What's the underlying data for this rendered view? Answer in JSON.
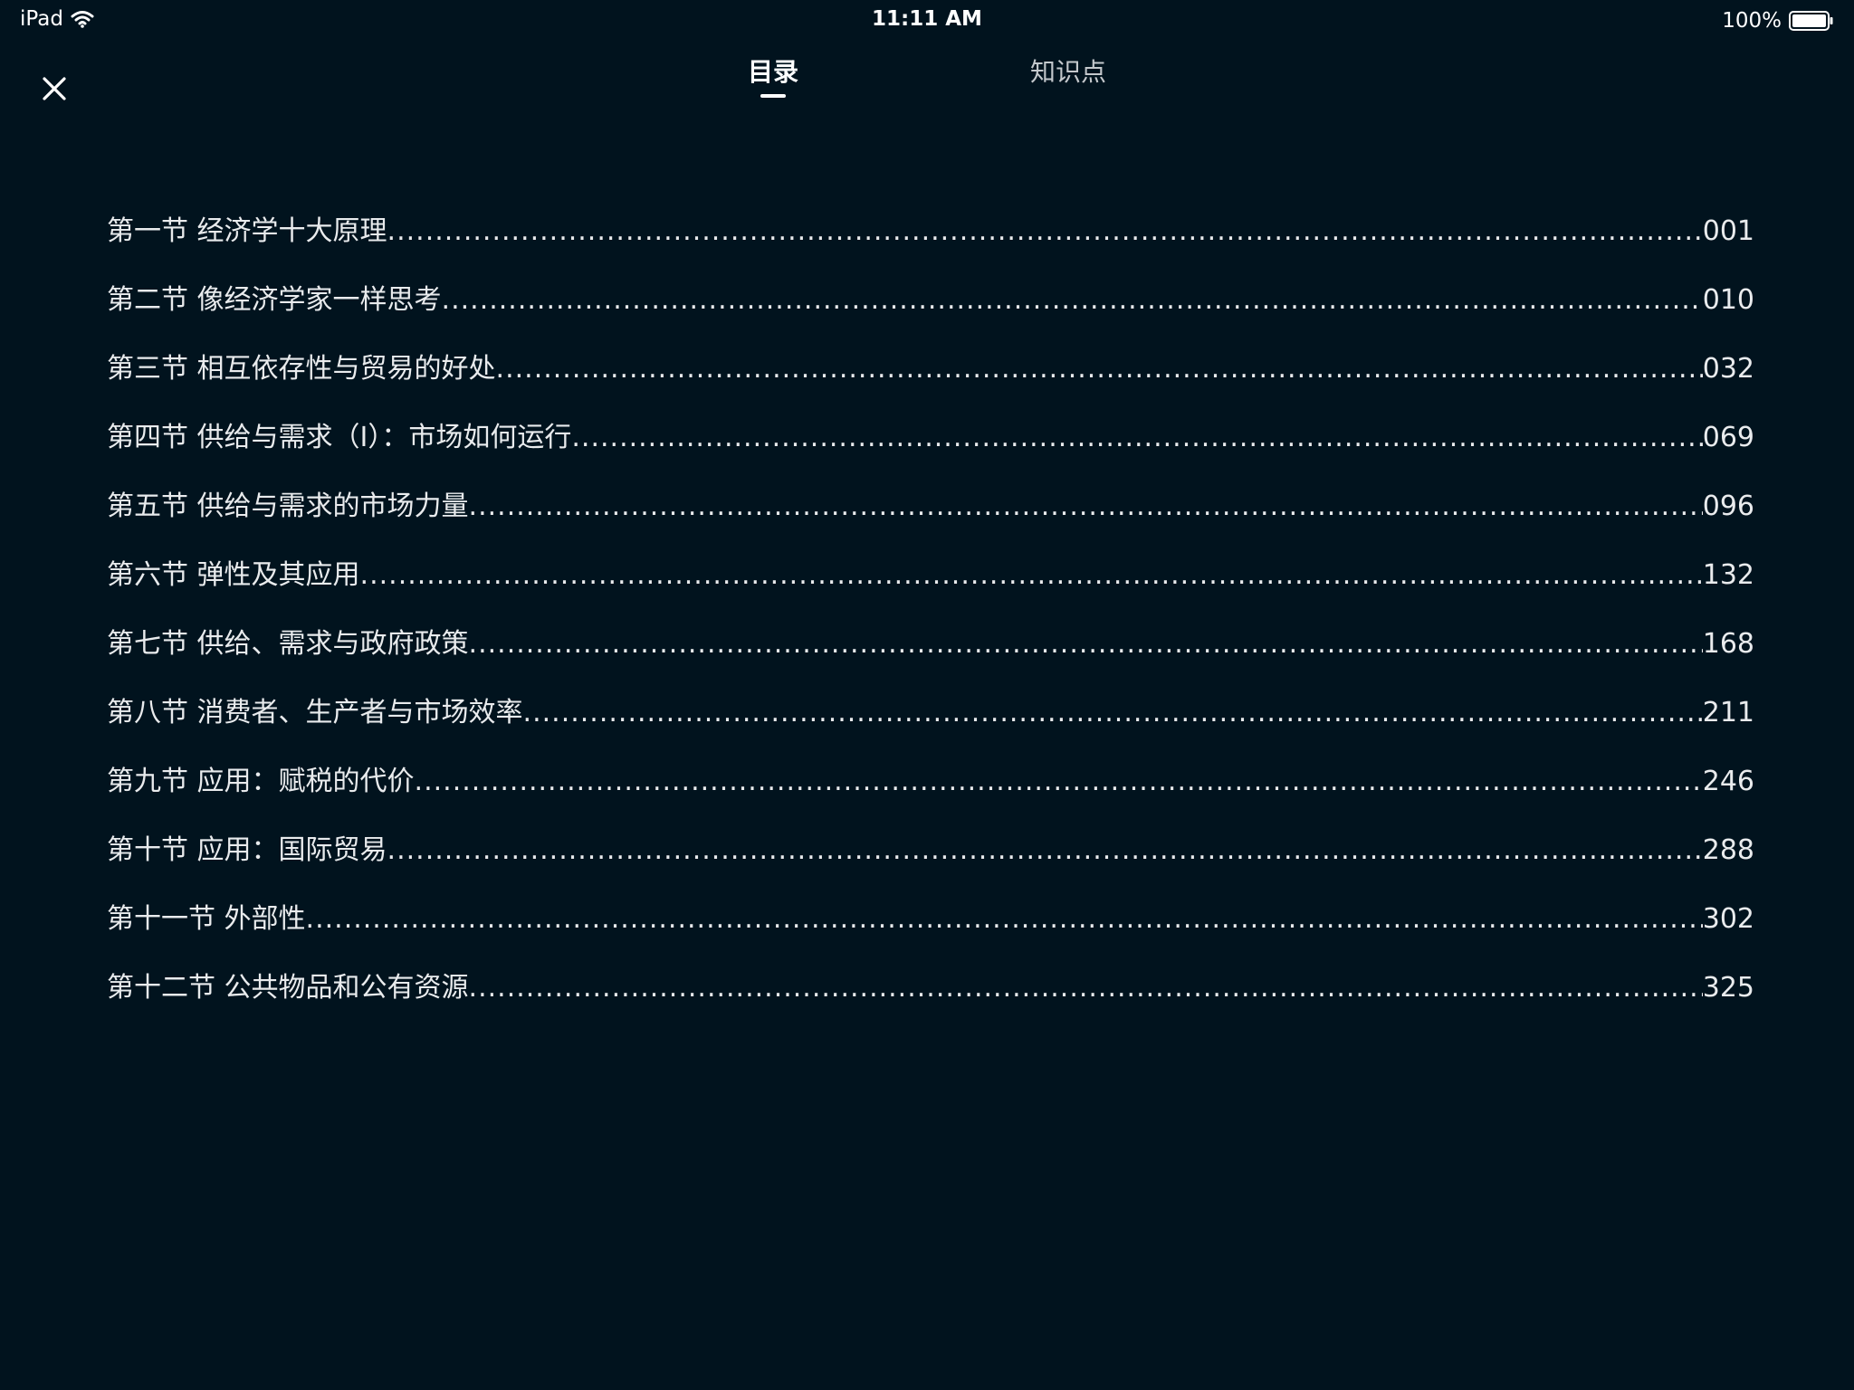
{
  "status_bar": {
    "device": "iPad",
    "time": "11:11 AM",
    "battery": "100%"
  },
  "tabs": [
    {
      "label": "目录",
      "active": true
    },
    {
      "label": "知识点",
      "active": false
    }
  ],
  "toc": [
    {
      "title": "第一节 经济学十大原理",
      "page": "001"
    },
    {
      "title": "第二节 像经济学家一样思考",
      "page": "010"
    },
    {
      "title": "第三节 相互依存性与贸易的好处",
      "page": "032"
    },
    {
      "title": "第四节 供给与需求（I）：市场如何运行",
      "page": "069"
    },
    {
      "title": "第五节 供给与需求的市场力量",
      "page": "096"
    },
    {
      "title": "第六节 弹性及其应用",
      "page": "132"
    },
    {
      "title": "第七节 供给、需求与政府政策",
      "page": "168"
    },
    {
      "title": "第八节 消费者、生产者与市场效率",
      "page": "211"
    },
    {
      "title": "第九节 应用：赋税的代价",
      "page": "246"
    },
    {
      "title": "第十节 应用：国际贸易",
      "page": "288"
    },
    {
      "title": "第十一节 外部性",
      "page": "302"
    },
    {
      "title": "第十二节 公共物品和公有资源",
      "page": "325"
    }
  ],
  "colors": {
    "background": "#01131e",
    "text": "#e9ebed",
    "inactive_tab": "#c4c8cc"
  },
  "icons": {
    "close": "close-icon",
    "wifi": "wifi-icon",
    "battery": "battery-icon"
  }
}
